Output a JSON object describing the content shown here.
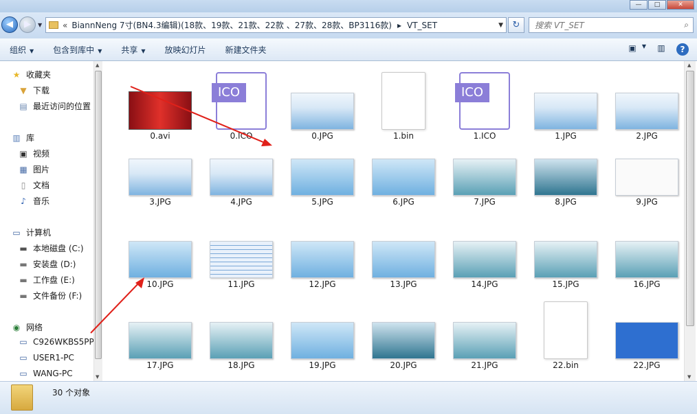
{
  "window": {
    "min_label": "—",
    "max_label": "□",
    "close_label": "✕"
  },
  "address_bar": {
    "back_label": "◀",
    "forward_label": "▶",
    "dropdown_glyph": "▼",
    "breadcrumb_separator": "«",
    "breadcrumb_path": "BiannNeng 7寸(BN4.3编辑)(18款、19款、21款、22款 、27款、28款、BP3116款)",
    "breadcrumb_arrow": "▸",
    "current_folder": "VT_SET",
    "refresh_label": "↻"
  },
  "search": {
    "placeholder": "搜索 VT_SET",
    "icon": "search-icon"
  },
  "toolbar": {
    "organize": "组织",
    "include_in_library": "包含到库中",
    "share": "共享",
    "slideshow": "放映幻灯片",
    "new_folder": "新建文件夹",
    "dropdown_glyph": "▼",
    "help_label": "?"
  },
  "nav": {
    "favorites_header": "收藏夹",
    "downloads": "下载",
    "recent_places": "最近访问的位置",
    "libraries_header": "库",
    "videos": "视频",
    "pictures": "图片",
    "documents": "文档",
    "music": "音乐",
    "computer_header": "计算机",
    "drive_c": "本地磁盘 (C:)",
    "drive_d": "安装盘 (D:)",
    "drive_e": "工作盘 (E:)",
    "drive_f": "文件备份 (F:)",
    "network_header": "网络",
    "net_1": "C926WKBS5PP",
    "net_2": "USER1-PC",
    "net_3": "WANG-PC"
  },
  "files": [
    {
      "name": "0.avi",
      "kind": "video"
    },
    {
      "name": "0.ICO",
      "kind": "ico"
    },
    {
      "name": "0.JPG",
      "kind": "blank"
    },
    {
      "name": "1.bin",
      "kind": "doc"
    },
    {
      "name": "1.ICO",
      "kind": "ico"
    },
    {
      "name": "1.JPG",
      "kind": "blank"
    },
    {
      "name": "2.JPG",
      "kind": "blank"
    },
    {
      "name": "3.JPG",
      "kind": "blank"
    },
    {
      "name": "4.JPG",
      "kind": "blank"
    },
    {
      "name": "5.JPG",
      "kind": "blue"
    },
    {
      "name": "6.JPG",
      "kind": "blue"
    },
    {
      "name": "7.JPG",
      "kind": "teal"
    },
    {
      "name": "8.JPG",
      "kind": "dark"
    },
    {
      "name": "9.JPG",
      "kind": "light"
    },
    {
      "name": "10.JPG",
      "kind": "blue"
    },
    {
      "name": "11.JPG",
      "kind": "table"
    },
    {
      "name": "12.JPG",
      "kind": "blue"
    },
    {
      "name": "13.JPG",
      "kind": "blue"
    },
    {
      "name": "14.JPG",
      "kind": "teal"
    },
    {
      "name": "15.JPG",
      "kind": "teal"
    },
    {
      "name": "16.JPG",
      "kind": "teal"
    },
    {
      "name": "17.JPG",
      "kind": "teal"
    },
    {
      "name": "18.JPG",
      "kind": "teal"
    },
    {
      "name": "19.JPG",
      "kind": "blue"
    },
    {
      "name": "20.JPG",
      "kind": "dark"
    },
    {
      "name": "21.JPG",
      "kind": "teal"
    },
    {
      "name": "22.bin",
      "kind": "doc"
    },
    {
      "name": "22.JPG",
      "kind": "grid"
    }
  ],
  "status": {
    "item_count": "30 个对象"
  },
  "colors": {
    "accent_blue": "#1e395b",
    "annotation_red": "#e0211a"
  }
}
